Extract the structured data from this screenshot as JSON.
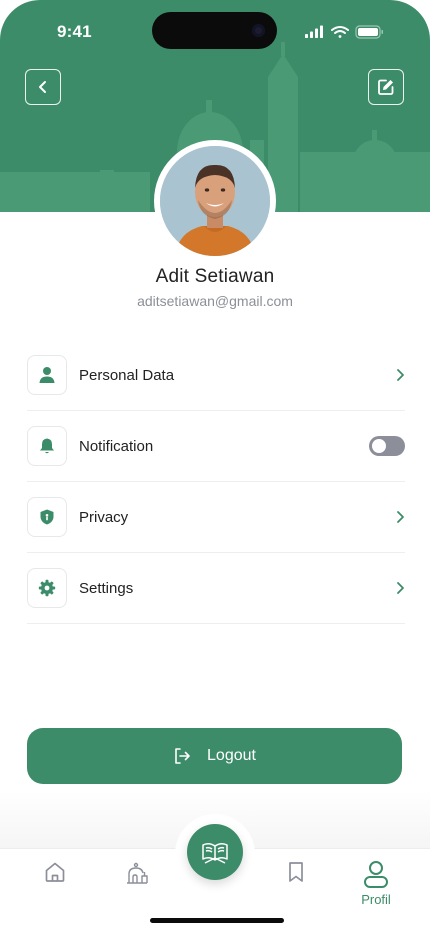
{
  "status_bar": {
    "time": "9:41"
  },
  "profile": {
    "name": "Adit Setiawan",
    "email": "aditsetiawan@gmail.com"
  },
  "menu": [
    {
      "label": "Personal Data",
      "icon": "person-icon",
      "action": "chevron"
    },
    {
      "label": "Notification",
      "icon": "bell-icon",
      "action": "toggle",
      "enabled": false
    },
    {
      "label": "Privacy",
      "icon": "shield-icon",
      "action": "chevron"
    },
    {
      "label": "Settings",
      "icon": "gear-icon",
      "action": "chevron"
    }
  ],
  "logout": {
    "label": "Logout"
  },
  "bottom_nav": {
    "items": [
      {
        "icon": "home-icon"
      },
      {
        "icon": "mosque-icon"
      },
      {
        "icon": "quran-icon"
      },
      {
        "icon": "bookmark-icon"
      },
      {
        "icon": "profile-icon",
        "label": "Profil",
        "active": true
      }
    ]
  },
  "colors": {
    "primary": "#3d8c69",
    "inactive": "#8c8f9a"
  }
}
